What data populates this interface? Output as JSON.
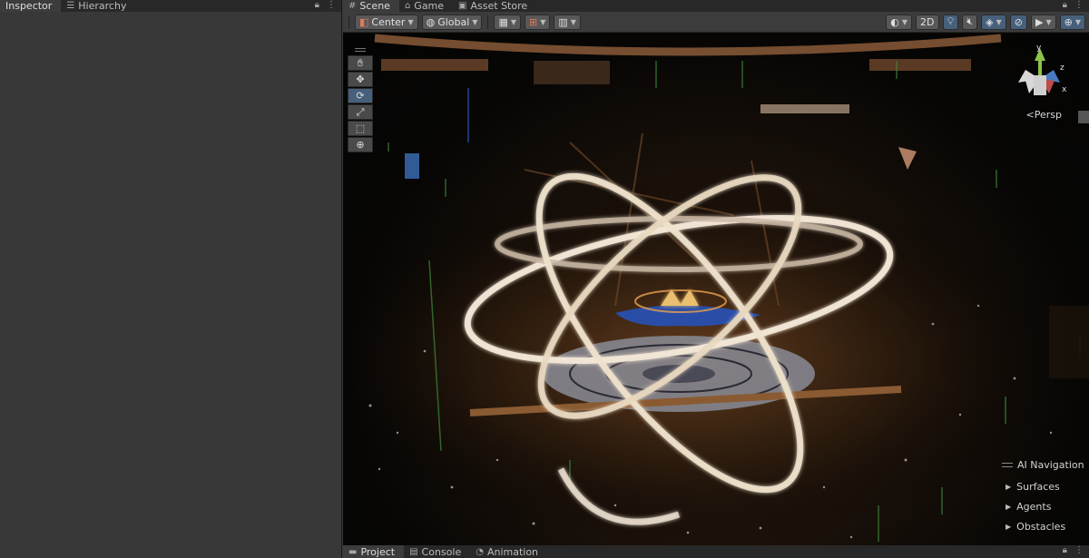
{
  "left_panel": {
    "tabs": [
      {
        "label": "Inspector",
        "icon": "inspector-icon"
      },
      {
        "label": "Hierarchy",
        "icon": "hierarchy-icon"
      }
    ]
  },
  "scene_panel": {
    "tabs": [
      {
        "label": "Scene",
        "icon": "grid-icon"
      },
      {
        "label": "Game",
        "icon": "gamepad-icon"
      },
      {
        "label": "Asset Store",
        "icon": "store-icon"
      }
    ],
    "toolbar": {
      "pivot_label": "Center",
      "space_label": "Global",
      "mode_2d_label": "2D"
    },
    "tools": [
      "hand-tool-icon",
      "move-tool-icon",
      "rotate-tool-icon",
      "scale-tool-icon",
      "rect-tool-icon",
      "transform-tool-icon"
    ],
    "active_tool_index": 2,
    "gizmo": {
      "y_label": "y",
      "z_label": "z",
      "x_label": "x"
    },
    "projection_label": "Persp",
    "ai_navigation": {
      "title": "AI Navigation",
      "items": [
        "Surfaces",
        "Agents",
        "Obstacles"
      ]
    }
  },
  "bottom_panel": {
    "tabs": [
      {
        "label": "Project",
        "icon": "folder-icon"
      },
      {
        "label": "Console",
        "icon": "console-icon"
      },
      {
        "label": "Animation",
        "icon": "animation-icon"
      }
    ]
  },
  "colors": {
    "accent": "#46607c",
    "panel": "#383838",
    "tabbar": "#282828",
    "ring_glow": "#f2e6d6"
  }
}
